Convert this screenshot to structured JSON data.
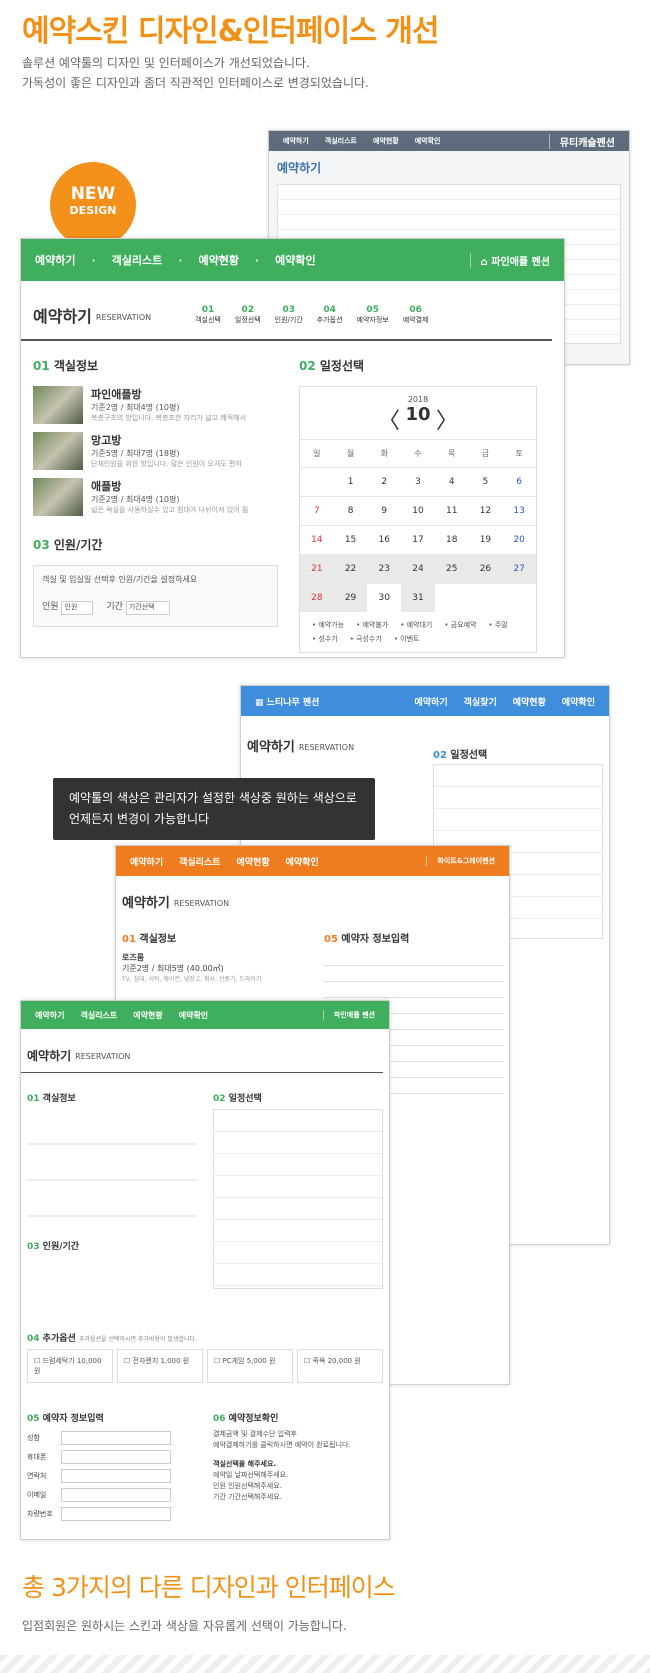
{
  "headline": "예약스킨 디자인&인터페이스 개선",
  "desc1": "솔루션 예약툴의 디자인 및 인터페이스가 개선되었습니다.",
  "desc2": "가독성이 좋은 디자인과 좀더 직관적인 인터페이스로 변경되었습니다.",
  "badge": {
    "line1": "NEW",
    "line2": "DESIGN"
  },
  "nav": {
    "items": [
      "예약하기",
      "객실리스트",
      "예약현황",
      "예약확인"
    ],
    "home": "파인애플 펜션",
    "dot": "·"
  },
  "reservation": {
    "title": "예약하기",
    "sub": "RESERVATION"
  },
  "steps": [
    {
      "num": "01",
      "label": "객실선택"
    },
    {
      "num": "02",
      "label": "일정선택"
    },
    {
      "num": "03",
      "label": "인원/기간"
    },
    {
      "num": "04",
      "label": "추가옵션"
    },
    {
      "num": "05",
      "label": "예약자정보"
    },
    {
      "num": "06",
      "label": "예약결제"
    }
  ],
  "sections": {
    "rooms": {
      "num": "01",
      "label": "객실정보"
    },
    "date": {
      "num": "02",
      "label": "일정선택"
    },
    "people": {
      "num": "03",
      "label": "인원/기간"
    },
    "options": {
      "num": "04",
      "label": "추가옵션"
    },
    "info": {
      "num": "05",
      "label": "예약자 정보입력"
    },
    "confirm": {
      "num": "06",
      "label": "예약정보확인"
    }
  },
  "rooms": [
    {
      "name": "파인애플방",
      "cap": "기준2명 / 최대4명 (10평)",
      "desc": "복층구조의 방입니다. 복층조한 자리가 넓고 쾌적해서"
    },
    {
      "name": "망고방",
      "cap": "기준5명 / 최대7명 (18평)",
      "desc": "단체인원을 위한 방입니다. 많은 인원이 오셔도 편히"
    },
    {
      "name": "애플방",
      "cap": "기준2명 / 최대4명 (10평)",
      "desc": "넓은 욕실을 사용하실수 있고 침대가 나뉘어져 있어 필"
    }
  ],
  "calendar": {
    "year": "2018",
    "month": "10",
    "prev": "〈",
    "next": "〉",
    "weekdays": [
      "일",
      "월",
      "화",
      "수",
      "목",
      "금",
      "토"
    ],
    "days": [
      "",
      "1",
      "2",
      "3",
      "4",
      "5",
      "6",
      "7",
      "8",
      "9",
      "10",
      "11",
      "12",
      "13",
      "14",
      "15",
      "16",
      "17",
      "18",
      "19",
      "20",
      "21",
      "22",
      "23",
      "24",
      "25",
      "26",
      "27",
      "28",
      "29",
      "30",
      "31",
      "",
      "",
      ""
    ]
  },
  "legend": [
    "예약가능",
    "예약불가",
    "예약대기",
    "금요예약",
    "주말",
    "성수기",
    "극성수기",
    "이벤트"
  ],
  "people_note": "객실 및 입실일 선택후 인원/기간을 설정하세요",
  "people_label": "인원",
  "people_select": "인원",
  "period_label": "기간",
  "period_select": "기간선택",
  "bubble": {
    "line1": "예약툴의 색상은 관리자가 설정한 색상중 원하는 색상으로",
    "line2": "언제든지 변경이 가능합니다"
  },
  "skins": {
    "blue_name": "느티나무 펜션",
    "blue_nav": [
      "예약하기",
      "객실찾기",
      "예약현황",
      "예약확인"
    ],
    "orange_home": "화이트&그레이펜션",
    "orange_nav": [
      "예약하기",
      "객실리스트",
      "예약현황",
      "예약확인"
    ],
    "old_home": "뮤티캐슬펜션",
    "orange_room": "로즈룸",
    "orange_room_cap": "기준2명 / 최대5명 (40.00㎡)",
    "orange_room_desc": "TV, 침대, 식탁, 에어컨, 냉장고, 취사, 선풍기, 드라이기"
  },
  "options": [
    {
      "name": "드럼세탁기",
      "price": "10,000 원"
    },
    {
      "name": "전자렌지",
      "price": "1,000 원"
    },
    {
      "name": "PC게임",
      "price": "5,000 원"
    },
    {
      "name": "족욕",
      "price": "20,000 원"
    }
  ],
  "options_note": "추가옵션을 선택하시면 추가비용이 발생합니다.",
  "info_fields": [
    "성함",
    "휴대폰",
    "연락처",
    "이메일",
    "차량번호"
  ],
  "confirm": {
    "note1": "결제금액 및 결제수단 입력후",
    "note2": "예약결제하기를 클릭하시면 예약이 완료됩니다.",
    "choose": "객실선택을 해주세요.",
    "rows": [
      {
        "k": "예약일",
        "v": "날짜선택해주세요."
      },
      {
        "k": "인원",
        "v": "인원선택해주세요."
      },
      {
        "k": "기간",
        "v": "기간선택해주세요."
      }
    ]
  },
  "headline2": "총 3가지의 다른 디자인과 인터페이스",
  "desc3": "입점회원은 원하시는 스킨과 색상을 자유롭게 선택이 가능합니다.",
  "colors": {
    "accent": "#f39117",
    "green": "#3fae5d",
    "orange": "#ef7c1f",
    "blue": "#3f8edb"
  }
}
